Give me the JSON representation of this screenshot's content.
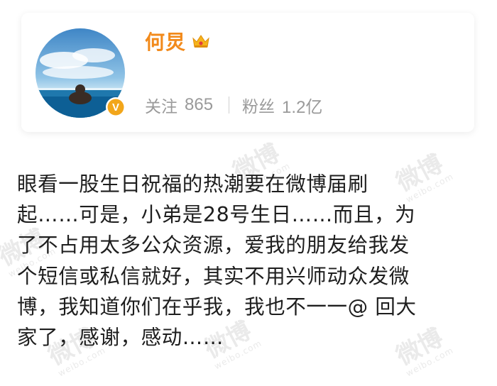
{
  "profile": {
    "name": "何炅",
    "follow_label": "关注",
    "follow_count": "865",
    "fans_label": "粉丝",
    "fans_count": "1.2亿",
    "name_color": "#f28a1b",
    "badge_icon": "crown-icon",
    "verified_icon": "verified-v-icon",
    "verified_badge_text": "V"
  },
  "post": {
    "lines": [
      "眼看一股生日祝福的热潮要在微博届刷",
      "起……可是，小弟是28号生日……而且，为",
      "了不占用太多公众资源，爱我的朋友给我发",
      "个短信或私信就好，其实不用兴师动众发微",
      "博，我知道你们在乎我，我也不一一@ 回大",
      "家了，感谢，感动……"
    ]
  },
  "watermark": {
    "text": "微博",
    "sub": "weibo.com"
  }
}
